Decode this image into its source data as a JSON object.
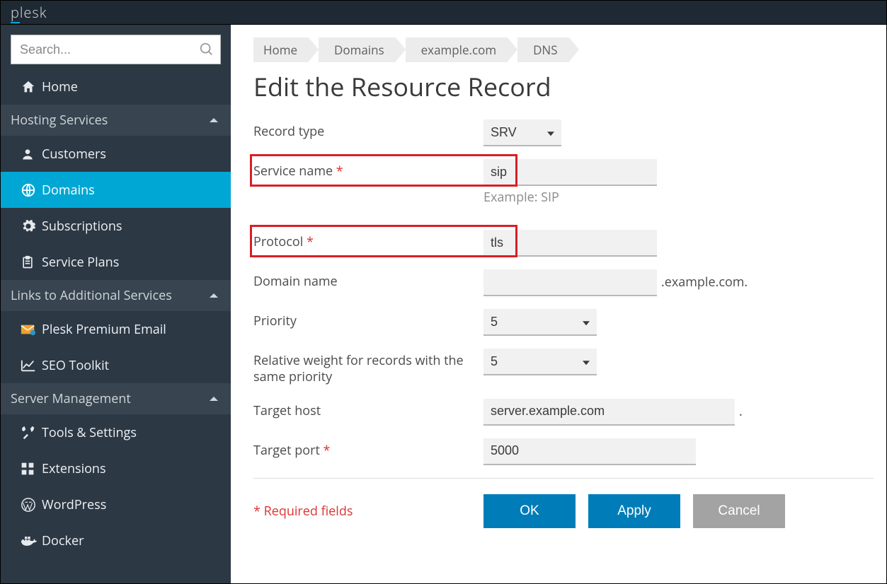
{
  "brand": "plesk",
  "search": {
    "placeholder": "Search..."
  },
  "sidebar": {
    "home": "Home",
    "sections": {
      "hosting": "Hosting Services",
      "links": "Links to Additional Services",
      "server": "Server Management"
    },
    "items": {
      "customers": "Customers",
      "domains": "Domains",
      "subscriptions": "Subscriptions",
      "service_plans": "Service Plans",
      "premium_email": "Plesk Premium Email",
      "seo_toolkit": "SEO Toolkit",
      "tools_settings": "Tools & Settings",
      "extensions": "Extensions",
      "wordpress": "WordPress",
      "docker": "Docker"
    }
  },
  "breadcrumbs": [
    "Home",
    "Domains",
    "example.com",
    "DNS"
  ],
  "page_title": "Edit the Resource Record",
  "form": {
    "record_type": {
      "label": "Record type",
      "value": "SRV"
    },
    "service_name": {
      "label": "Service name",
      "value": "sip",
      "hint": "Example: SIP"
    },
    "protocol": {
      "label": "Protocol",
      "value": "tls"
    },
    "domain_name": {
      "label": "Domain name",
      "value": "",
      "suffix": ".example.com."
    },
    "priority": {
      "label": "Priority",
      "value": "5"
    },
    "relative_weight": {
      "label": "Relative weight for records with the same priority",
      "value": "5"
    },
    "target_host": {
      "label": "Target host",
      "value": "server.example.com",
      "suffix": "."
    },
    "target_port": {
      "label": "Target port",
      "value": "5000"
    }
  },
  "required_note": "Required fields",
  "buttons": {
    "ok": "OK",
    "apply": "Apply",
    "cancel": "Cancel"
  }
}
